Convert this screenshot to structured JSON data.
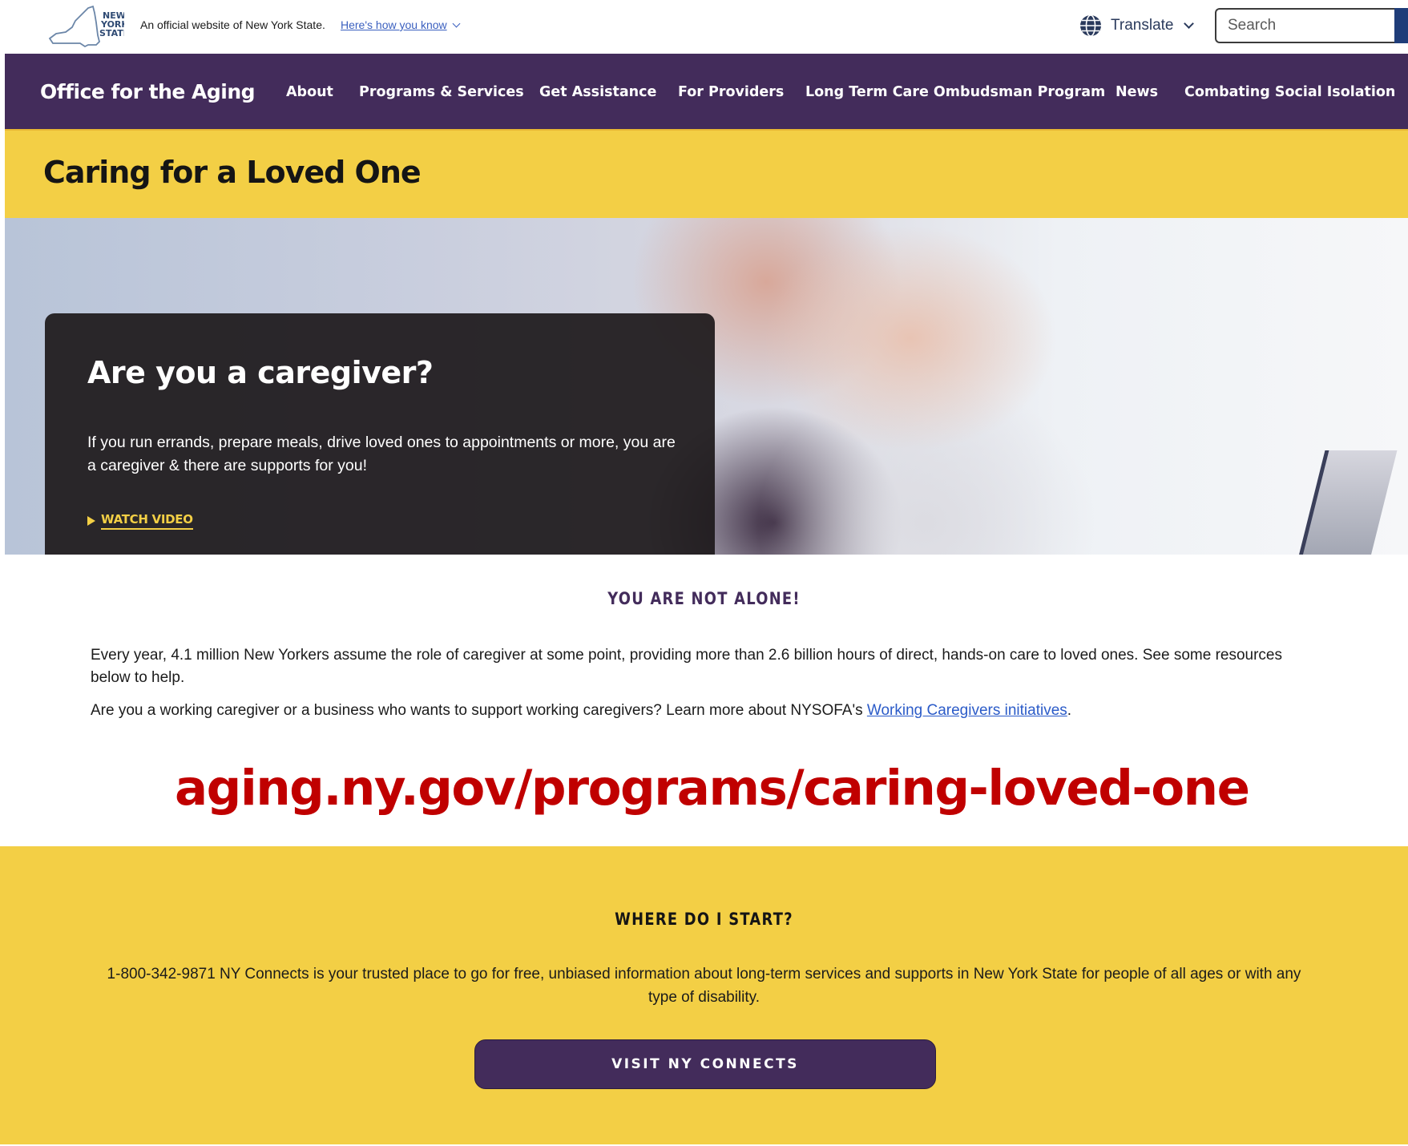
{
  "banner": {
    "logo_text": "NEW YORK STATE",
    "official_text": "An official website of New York State.",
    "how_you_know": "Here's how you know",
    "translate_label": "Translate",
    "search_placeholder": "Search"
  },
  "nav": {
    "brand": "Office for the Aging",
    "items": [
      {
        "label": "About"
      },
      {
        "label": "Programs & Services"
      },
      {
        "label": "Get Assistance"
      },
      {
        "label": "For Providers"
      },
      {
        "label": "Long Term Care Ombudsman Program"
      },
      {
        "label": "News"
      },
      {
        "label": "Combating Social Isolation"
      }
    ]
  },
  "page_title": "Caring for a Loved One",
  "hero": {
    "heading": "Are you a caregiver?",
    "text": "If you run errands, prepare meals, drive loved ones to appointments or more, you are a caregiver & there are supports for you!",
    "cta": "WATCH VIDEO"
  },
  "not_alone": {
    "kicker": "YOU ARE NOT ALONE!",
    "p1": "Every year, 4.1 million New Yorkers assume the role of caregiver at some point, providing more than 2.6 billion hours of direct, hands-on care to loved ones. See some resources below to help.",
    "p2_prefix": "Are you a working caregiver or a business who wants to support working caregivers? Learn more about NYSOFA's ",
    "p2_link": "Working Caregivers initiatives",
    "p2_suffix": "."
  },
  "url_overlay": "aging.ny.gov/programs/caring-loved-one",
  "start": {
    "kicker": "WHERE DO I START?",
    "text": "1-800-342-9871 NY Connects is your trusted place to go for free, unbiased information about long-term services and supports in New York State for people of all ages or with any type of disability.",
    "button": "VISIT NY CONNECTS"
  },
  "colors": {
    "purple": "#432c5b",
    "yellow": "#f3cf45",
    "link_blue": "#2b5bc8",
    "overlay_red": "#c00000"
  },
  "icons": [
    "ny-state-logo-icon",
    "chevron-down-icon",
    "globe-icon",
    "play-icon"
  ]
}
